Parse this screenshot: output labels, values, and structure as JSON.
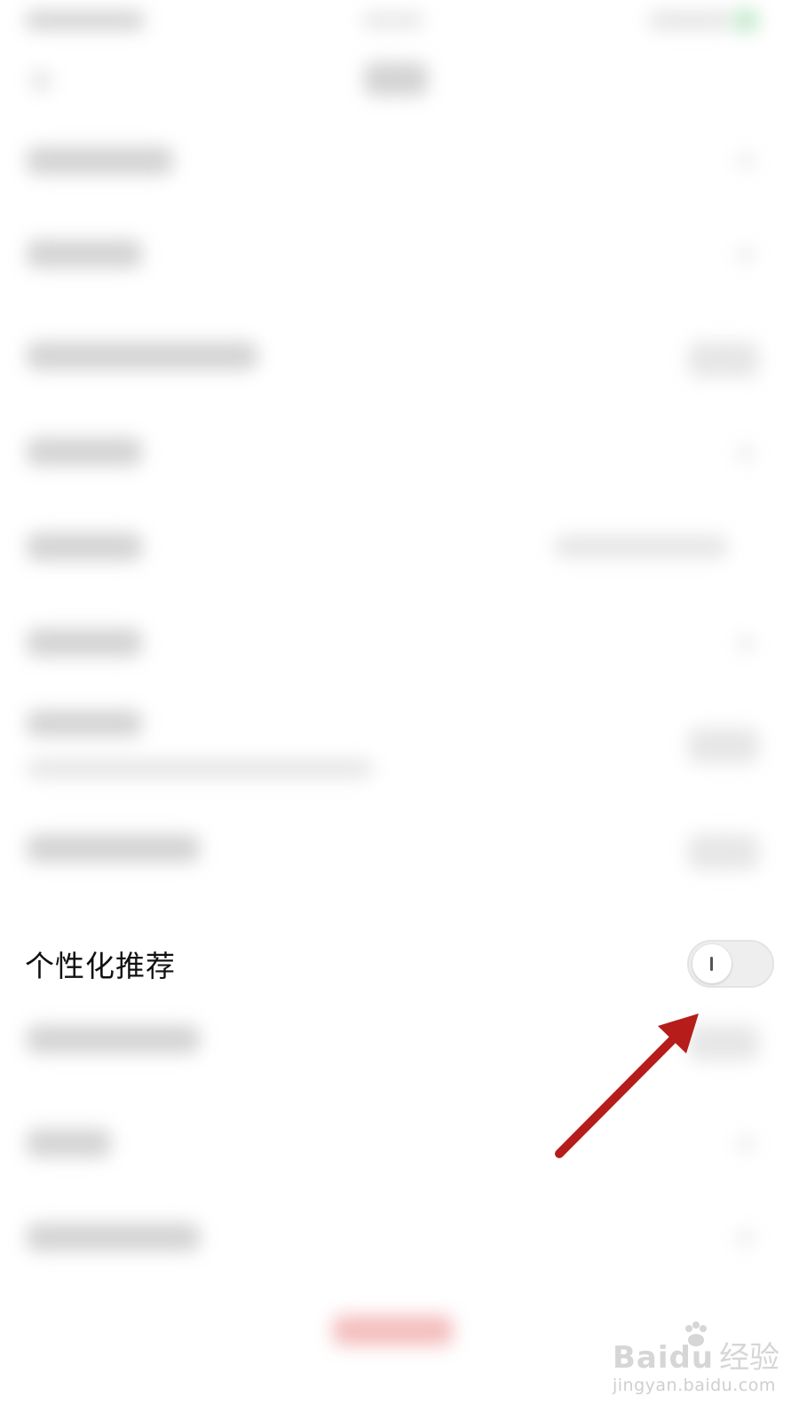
{
  "settings": {
    "personalized_recommendation": {
      "label": "个性化推荐",
      "toggle_on": false
    }
  },
  "annotation": {
    "arrow_color": "#b51c1a"
  },
  "watermark": {
    "brand": "Baidu",
    "brand_suffix": "经验",
    "url": "jingyan.baidu.com"
  }
}
